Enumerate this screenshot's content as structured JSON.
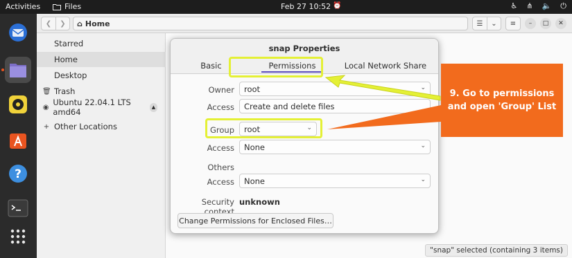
{
  "topbar": {
    "activities": "Activities",
    "app_name": "Files",
    "datetime": "Feb 27  10:52"
  },
  "files": {
    "path": "Home",
    "sidebar": [
      {
        "label": "Starred",
        "icon": ""
      },
      {
        "label": "Home",
        "icon": "home-icon"
      },
      {
        "label": "Desktop",
        "icon": ""
      },
      {
        "label": "Trash",
        "icon": "trash-icon"
      },
      {
        "label": "Ubuntu 22.04.1 LTS amd64",
        "icon": "disc-icon"
      },
      {
        "label": "Other Locations",
        "icon": "plus-icon"
      }
    ],
    "status": "\"snap\" selected  (containing 3 items)"
  },
  "dialog": {
    "title": "snap Properties",
    "tabs": [
      "Basic",
      "Permissions",
      "Local Network Share"
    ],
    "active_tab": "Permissions",
    "owner_label": "Owner",
    "owner_value": "root",
    "owner_access_label": "Access",
    "owner_access_value": "Create and delete files",
    "group_label": "Group",
    "group_value": "root",
    "group_access_label": "Access",
    "group_access_value": "None",
    "others_label": "Others",
    "others_access_label": "Access",
    "others_access_value": "None",
    "security_context_label": "Security context",
    "security_context_value": "unknown",
    "enclosed_button": "Change Permissions for Enclosed Files…"
  },
  "annotation": {
    "callout_text": "9. Go to permissions and open 'Group' List",
    "highlight_color": "#e4f035",
    "callout_color": "#f26b1d"
  },
  "colors": {
    "accent": "#5d4dbf",
    "dock": "#2b2b2b",
    "topbar": "#1d1d1d"
  }
}
